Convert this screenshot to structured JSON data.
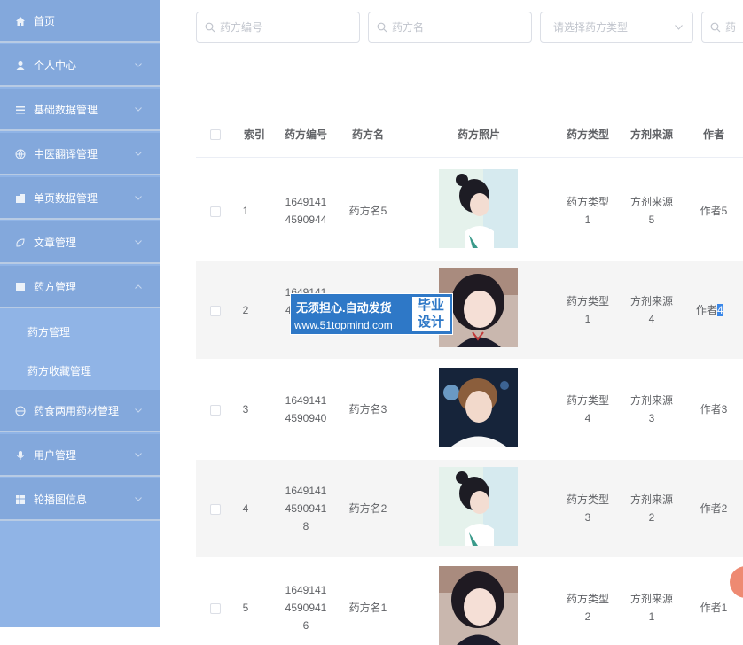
{
  "sidebar": {
    "items": [
      {
        "label": "首页",
        "icon": "home-icon"
      },
      {
        "label": "个人中心",
        "icon": "user-icon"
      },
      {
        "label": "基础数据管理",
        "icon": "list-icon"
      },
      {
        "label": "中医翻译管理",
        "icon": "globe-icon"
      },
      {
        "label": "单页数据管理",
        "icon": "building-icon"
      },
      {
        "label": "文章管理",
        "icon": "leaf-icon"
      },
      {
        "label": "药方管理",
        "icon": "grid-icon"
      },
      {
        "label": "药食两用药材管理",
        "icon": "globe-icon"
      },
      {
        "label": "用户管理",
        "icon": "mic-icon"
      },
      {
        "label": "轮播图信息",
        "icon": "grid-icon"
      }
    ],
    "subitems": [
      "药方管理",
      "药方收藏管理"
    ]
  },
  "search": {
    "code_placeholder": "药方编号",
    "name_placeholder": "药方名",
    "type_placeholder": "请选择药方类型",
    "extra_placeholder": "药"
  },
  "table": {
    "headers": [
      "索引",
      "药方编号",
      "药方名",
      "药方照片",
      "药方类型",
      "方剂来源",
      "作者"
    ],
    "rows": [
      {
        "index": "1",
        "code": [
          "1649141",
          "4590944"
        ],
        "name": "药方名5",
        "type": [
          "药方类型",
          "1"
        ],
        "source": [
          "方剂来源",
          "5"
        ],
        "author": "作者5"
      },
      {
        "index": "2",
        "code": [
          "1649141",
          "4"
        ],
        "name": "",
        "type": [
          "药方类型",
          "1"
        ],
        "source": [
          "方剂来源",
          "4"
        ],
        "author_prefix": "作者",
        "author_selected": "4"
      },
      {
        "index": "3",
        "code": [
          "1649141",
          "4590940"
        ],
        "name": "药方名3",
        "type": [
          "药方类型",
          "4"
        ],
        "source": [
          "方剂来源",
          "3"
        ],
        "author": "作者3"
      },
      {
        "index": "4",
        "code": [
          "1649141",
          "4590941",
          "8"
        ],
        "name": "药方名2",
        "type": [
          "药方类型",
          "3"
        ],
        "source": [
          "方剂来源",
          "2"
        ],
        "author": "作者2"
      },
      {
        "index": "5",
        "code": [
          "1649141",
          "4590941",
          "6"
        ],
        "name": "药方名1",
        "type": [
          "药方类型",
          "2"
        ],
        "source": [
          "方剂来源",
          "1"
        ],
        "author": "作者1"
      }
    ]
  },
  "ad": {
    "line1": "无须担心.自动发货",
    "line2": "www.51topmind.com",
    "badge_top": "毕业",
    "badge_bottom": "设计"
  },
  "colors": {
    "sidebar": "#90b4e6",
    "sidebar_item": "#83a8dc",
    "text": "#606266",
    "placeholder": "#c0c4cc",
    "selection": "#3a87e8",
    "ad_blue": "#2e78c7",
    "float_button": "#ee8a72"
  }
}
